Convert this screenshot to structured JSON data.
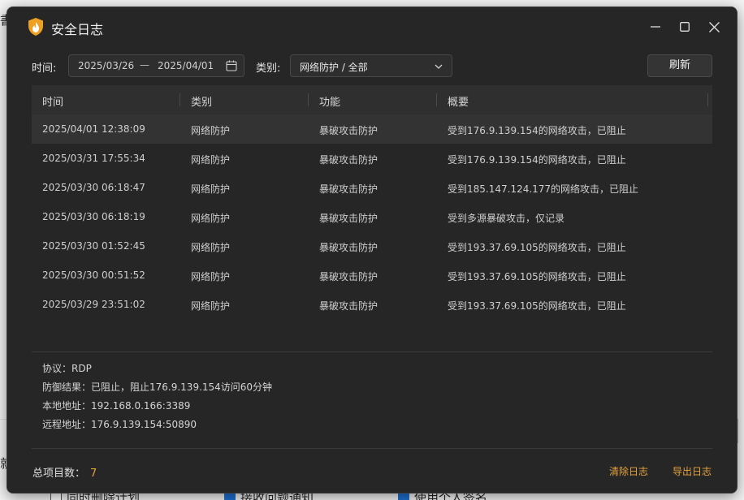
{
  "window": {
    "title": "安全日志",
    "minimize_icon": "minimize-icon",
    "maximize_icon": "maximize-icon",
    "close_icon": "close-icon"
  },
  "filters": {
    "time_label": "时间:",
    "date_start": "2025/03/26",
    "date_separator": "—",
    "date_end": "2025/04/01",
    "category_label": "类别:",
    "category_value": "网络防护 / 全部",
    "refresh_label": "刷新"
  },
  "table": {
    "columns": [
      "时间",
      "类别",
      "功能",
      "概要"
    ],
    "rows": [
      {
        "time": "2025/04/01 12:38:09",
        "category": "网络防护",
        "function": "暴破攻击防护",
        "summary": "受到176.9.139.154的网络攻击，已阻止"
      },
      {
        "time": "2025/03/31 17:55:34",
        "category": "网络防护",
        "function": "暴破攻击防护",
        "summary": "受到176.9.139.154的网络攻击，已阻止"
      },
      {
        "time": "2025/03/30 06:18:47",
        "category": "网络防护",
        "function": "暴破攻击防护",
        "summary": "受到185.147.124.177的网络攻击，已阻止"
      },
      {
        "time": "2025/03/30 06:18:19",
        "category": "网络防护",
        "function": "暴破攻击防护",
        "summary": "受到多源暴破攻击，仅记录"
      },
      {
        "time": "2025/03/30 01:52:45",
        "category": "网络防护",
        "function": "暴破攻击防护",
        "summary": "受到193.37.69.105的网络攻击，已阻止"
      },
      {
        "time": "2025/03/30 00:51:52",
        "category": "网络防护",
        "function": "暴破攻击防护",
        "summary": "受到193.37.69.105的网络攻击，已阻止"
      },
      {
        "time": "2025/03/29 23:51:02",
        "category": "网络防护",
        "function": "暴破攻击防护",
        "summary": "受到193.37.69.105的网络攻击，已阻止"
      }
    ]
  },
  "details": {
    "protocol": "协议：RDP",
    "result": "防御结果：已阻止，阻止176.9.139.154访问60分钟",
    "local_address": "本地地址：192.168.0.166:3389",
    "remote_address": "远程地址：176.9.139.154:50890"
  },
  "footer": {
    "total_label": "总项目数：",
    "total_count": "7",
    "clear_label": "清除日志",
    "export_label": "导出日志"
  },
  "background": {
    "left_char_top": "書",
    "left_char_bottom": "就",
    "checks": [
      {
        "label": "同时删除计划",
        "checked": false
      },
      {
        "label": "接收问题通知",
        "checked": true
      },
      {
        "label": "使用个人签名",
        "checked": true
      }
    ]
  },
  "colors": {
    "window_bg": "#262626",
    "accent": "#e6a23c",
    "header_bg": "#2f2f2f",
    "selected_row_bg": "#333333"
  }
}
